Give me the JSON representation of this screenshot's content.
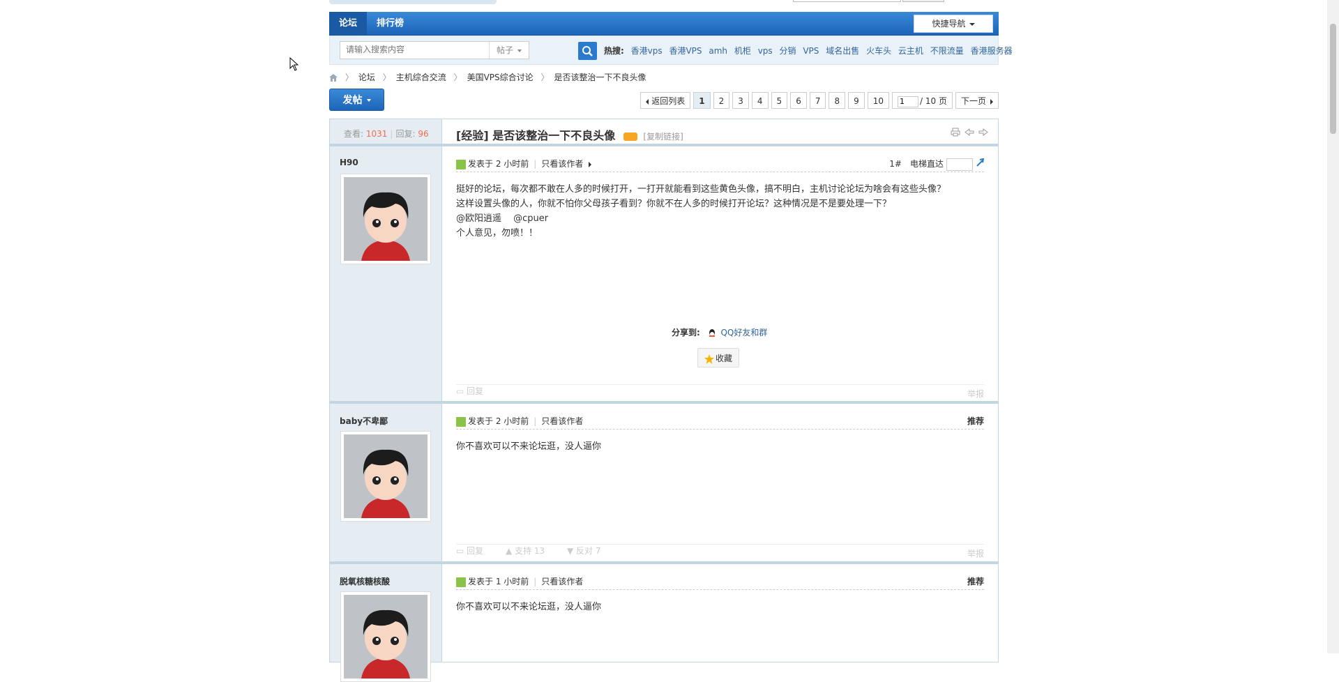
{
  "nav": {
    "tabs": [
      "论坛",
      "排行榜"
    ],
    "quick_nav": "快捷导航"
  },
  "search": {
    "placeholder": "请输入搜索内容",
    "type": "帖子",
    "hot_label": "热搜:",
    "hot_terms": [
      "香港vps",
      "香港VPS",
      "amh",
      "机柜",
      "vps",
      "分销",
      "VPS",
      "域名出售",
      "火车头",
      "云主机",
      "不限流量",
      "香港服务器"
    ]
  },
  "breadcrumb": [
    "论坛",
    "主机综合交流",
    "美国VPS综合讨论",
    "是否该整治一下不良头像"
  ],
  "post_button": "发帖",
  "pager": {
    "back": "返回列表",
    "pages": [
      "1",
      "2",
      "3",
      "4",
      "5",
      "6",
      "7",
      "8",
      "9",
      "10"
    ],
    "current": "1",
    "jump_value": "1",
    "total": "/ 10 页",
    "next": "下一页"
  },
  "thread": {
    "views_label": "查看:",
    "views": "1031",
    "replies_label": "回复:",
    "replies": "96",
    "prefix": "[经验]",
    "title": "是否该整治一下不良头像",
    "copy_link": "[复制链接]"
  },
  "posts": [
    {
      "user": "H90",
      "time": "发表于 2 小时前",
      "only_author": "只看该作者",
      "floor": "1#",
      "elevator": "电梯直达",
      "lines": [
        "挺好的论坛，每次都不敢在人多的时候打开，一打开就能看到这些黄色头像，搞不明白，主机讨论论坛为啥会有这些头像？",
        "这样设置头像的人，你就不怕你父母孩子看到？你就不在人多的时候打开论坛？这种情况是不是要处理一下？",
        "@欧阳逍遥　 @cpuer",
        "个人意见，勿喷！！"
      ],
      "share_label": "分享到:",
      "share_target": "QQ好友和群",
      "favorite": "收藏",
      "reply": "回复",
      "report": "举报"
    },
    {
      "user": "baby不卑鄙",
      "time": "发表于 2 小时前",
      "only_author": "只看该作者",
      "recommend": "推荐",
      "text": "你不喜欢可以不来论坛逛，没人逼你",
      "reply": "回复",
      "support": "支持 13",
      "oppose": "反对 7",
      "report": "举报"
    },
    {
      "user": "脱氧核糖核酸",
      "time": "发表于 1 小时前",
      "only_author": "只看该作者",
      "recommend": "推荐",
      "text": "你不喜欢可以不来论坛逛，没人逼你"
    }
  ]
}
